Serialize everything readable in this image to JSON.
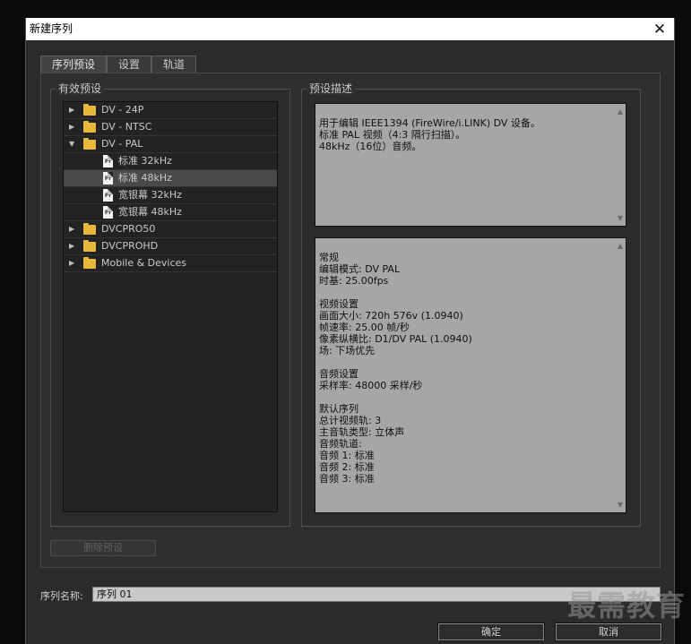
{
  "window": {
    "title": "新建序列",
    "close_glyph": "✕"
  },
  "tabs": [
    {
      "label": "序列预设",
      "active": true
    },
    {
      "label": "设置",
      "active": false
    },
    {
      "label": "轨道",
      "active": false
    }
  ],
  "presets_panel": {
    "label": "有效预设"
  },
  "description_panel": {
    "label": "预设描述"
  },
  "tree": {
    "items": [
      {
        "label": "DV - 24P",
        "arrow": "▶"
      },
      {
        "label": "DV - NTSC",
        "arrow": "▶"
      },
      {
        "label": "DV - PAL",
        "arrow": "▼"
      },
      {
        "label": "标准 32kHz",
        "icon": "Pr"
      },
      {
        "label": "标准 48kHz",
        "icon": "Pr"
      },
      {
        "label": "宽银幕 32kHz",
        "icon": "Pr"
      },
      {
        "label": "宽银幕 48kHz",
        "icon": "Pr"
      },
      {
        "label": "DVCPRO50",
        "arrow": "▶"
      },
      {
        "label": "DVCPROHD",
        "arrow": "▶"
      },
      {
        "label": "Mobile & Devices",
        "arrow": "▶"
      }
    ]
  },
  "description_text": "用于编辑 IEEE1394 (FireWire/i.LINK) DV 设备。\n标准 PAL 视频（4:3 隔行扫描）。\n48kHz（16位）音频。",
  "details_text": "常规\n 编辑模式: DV PAL\n 时基: 25.00fps\n\n视频设置\n 画面大小: 720h 576v (1.0940)\n 帧速率: 25.00 帧/秒\n 像素纵横比: D1/DV PAL (1.0940)\n 场: 下场优先\n\n音频设置\n 采样率: 48000 采样/秒\n\n默认序列\n 总计视频轨: 3\n 主音轨类型: 立体声\n 音频轨道:\n 音频 1: 标准\n 音频 2: 标准\n 音频 3: 标准",
  "delete_button": "删除预设",
  "sequence_name": {
    "label": "序列名称:",
    "value": "序列 01"
  },
  "buttons": {
    "ok": "确定",
    "cancel": "取消"
  },
  "scroll": {
    "up": "▲",
    "down": "▼"
  },
  "watermark": "最需教育"
}
